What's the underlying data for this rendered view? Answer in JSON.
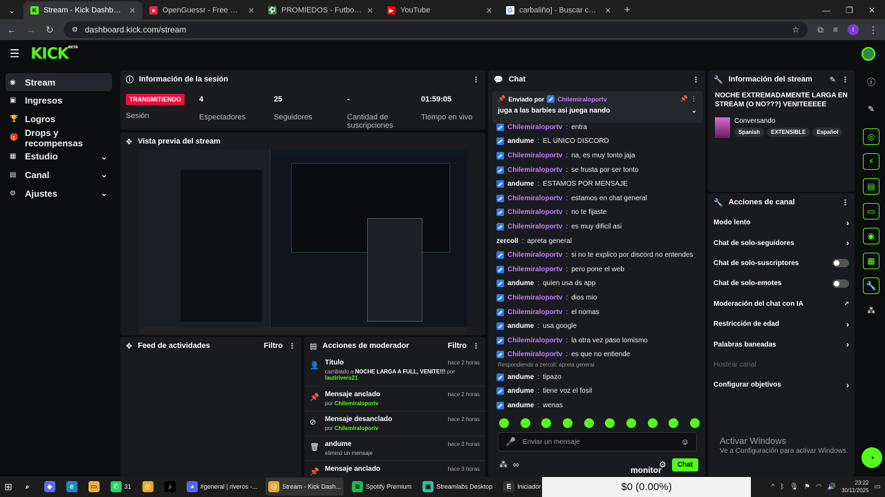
{
  "browser": {
    "tabs": [
      {
        "title": "Stream - Kick Dashboard",
        "icon": "kick-icon",
        "active": true
      },
      {
        "title": "OpenGuessr - Free GeoGuessr A",
        "icon": "openguessr-icon"
      },
      {
        "title": "PROMIEDOS - Futbol Argentino",
        "icon": "promiedos-icon"
      },
      {
        "title": "YouTube",
        "icon": "youtube-icon"
      },
      {
        "title": "carbaliño] - Buscar con Google",
        "icon": "google-icon"
      }
    ],
    "url": "dashboard.kick.com/stream",
    "profile_initial": "I"
  },
  "kick": {
    "logo": "KICK",
    "beta": "BETA"
  },
  "sidebar": {
    "items": [
      {
        "label": "Stream",
        "icon": "broadcast-icon"
      },
      {
        "label": "Ingresos",
        "icon": "wallet-icon"
      },
      {
        "label": "Logros",
        "icon": "trophy-icon"
      },
      {
        "label": "Drops y recompensas",
        "icon": "gift-icon"
      },
      {
        "label": "Estudio",
        "icon": "studio-icon"
      },
      {
        "label": "Canal",
        "icon": "channel-icon"
      },
      {
        "label": "Ajustes",
        "icon": "gear-icon"
      }
    ]
  },
  "session": {
    "title": "Información de la sesión",
    "live_badge": "TRANSMITIENDO",
    "session_label": "Sesión",
    "stats": [
      {
        "value": "4",
        "label": "Espectadores"
      },
      {
        "value": "25",
        "label": "Seguidores"
      },
      {
        "value": "-",
        "label": "Cantidad de suscripciones"
      },
      {
        "value": "01:59:05",
        "label": "Tiempo en vivo"
      }
    ]
  },
  "preview": {
    "title": "Vista previa del stream"
  },
  "activity": {
    "title": "Feed de actividades",
    "filter": "Filtro"
  },
  "moderator": {
    "title": "Acciones de moderador",
    "filter": "Filtro",
    "items": [
      {
        "title": "Título",
        "desc": "cambiado a",
        "highlight": "NOCHE LARGA A FULL, VENITE!!!",
        "suffix": "por",
        "user": "lautirivero21",
        "time": "hace 2 horas",
        "icon": "title-icon"
      },
      {
        "title": "Mensaje anclado",
        "desc": "por",
        "user": "Chilemiraloportv",
        "time": "hace 2 horas",
        "icon": "pin-icon"
      },
      {
        "title": "Mensaje desanclado",
        "desc": "por",
        "user": "Chilemiraloportv",
        "time": "hace 2 horas",
        "icon": "unpin-icon"
      },
      {
        "title": "andume",
        "desc": "eliminó un mensaje",
        "user": "",
        "time": "hace 3 horas",
        "icon": "trash-icon"
      },
      {
        "title": "Mensaje anclado",
        "desc": "",
        "user": "",
        "time": "hace 3 horas",
        "icon": "pin-icon"
      }
    ]
  },
  "chat": {
    "title": "Chat",
    "pinned_by_label": "Enviado por",
    "pinned_user": "Chilemiraloportv",
    "pinned_text": "juga a las barbies asi juega nando",
    "messages": [
      {
        "user": "Chilemiraloportv",
        "text": "entra"
      },
      {
        "user": "andume",
        "text": "EL UNICO DISCORD"
      },
      {
        "user": "Chilemiraloportv",
        "text": "na, es muy tonto jaja"
      },
      {
        "user": "Chilemiraloportv",
        "text": "se frusta por ser tonto"
      },
      {
        "user": "andume",
        "text": "ESTAMOS POR MENSAJE"
      },
      {
        "user": "Chilemiraloportv",
        "text": "estamos en chat general"
      },
      {
        "user": "Chilemiraloportv",
        "text": "no te fijaste"
      },
      {
        "user": "Chilemiraloportv",
        "text": "es muy dificil asi"
      },
      {
        "user": "zercoll",
        "text": "apreta general"
      },
      {
        "user": "Chilemiraloportv",
        "text": "si no te explico por discord no entendes"
      },
      {
        "user": "Chilemiraloportv",
        "text": "pero pone el web"
      },
      {
        "user": "andume",
        "text": "quien usa ds app"
      },
      {
        "user": "Chilemiraloportv",
        "text": "dios mio"
      },
      {
        "user": "Chilemiraloportv",
        "text": "el nomas"
      },
      {
        "user": "andume",
        "text": "usa google"
      },
      {
        "user": "Chilemiraloportv",
        "text": "la otra vez paso lomismo"
      },
      {
        "user": "Chilemiraloportv",
        "text": "es que no entiende"
      }
    ],
    "reply_note": "Respondiendo a zercoll: apreta general",
    "messages2": [
      {
        "user": "andume",
        "text": "tipazo"
      },
      {
        "user": "andume",
        "text": "tiene voz el fosil"
      },
      {
        "user": "andume",
        "text": "wenas"
      }
    ],
    "input_placeholder": "Enviar un mensaje",
    "send_label": "Chat",
    "monitor_label": "monitor"
  },
  "stream_info": {
    "title": "Información del stream",
    "stream_title": "NOCHE EXTREMADAMENTE LARGA EN STREAM (O NO???) VENITEEEEE",
    "category": "Conversando",
    "tags": [
      "Spanish",
      "EXTENSIBLE",
      "Español"
    ]
  },
  "channel_actions": {
    "title": "Acciones de canal",
    "items": [
      {
        "label": "Modo lento",
        "control": "arrow"
      },
      {
        "label": "Chat de solo-seguidores",
        "control": "arrow"
      },
      {
        "label": "Chat de solo-suscriptores",
        "control": "toggle"
      },
      {
        "label": "Chat de solo-emotes",
        "control": "toggle"
      },
      {
        "label": "Moderación del chat con IA",
        "control": "external"
      },
      {
        "label": "Restricción de edad",
        "control": "arrow"
      },
      {
        "label": "Palabras baneadas",
        "control": "arrow"
      },
      {
        "label": "Hostear canal",
        "control": "disabled"
      },
      {
        "label": "Configurar objetivos",
        "control": "arrow"
      }
    ]
  },
  "watermark": {
    "title": "Activar Windows",
    "subtitle": "Ve a Configuración para activar Windows."
  },
  "overlay": {
    "value": "$0 (0.00%)"
  },
  "taskbar": {
    "apps": [
      {
        "label": "",
        "icon": "search-icon"
      },
      {
        "label": "",
        "icon": "copilot-icon"
      },
      {
        "label": "",
        "icon": "edge-icon"
      },
      {
        "label": "",
        "icon": "explorer-icon"
      },
      {
        "label": "31",
        "icon": "whatsapp-icon"
      },
      {
        "label": "",
        "icon": "chrome-icon"
      },
      {
        "label": "",
        "icon": "tiktok-icon"
      },
      {
        "label": "#general | riveros -...",
        "icon": "discord-icon"
      },
      {
        "label": "Stream - Kick Dash...",
        "icon": "chrome-icon",
        "active": true
      },
      {
        "label": "Spotify Premium",
        "icon": "spotify-icon"
      },
      {
        "label": "Streamlabs Desktop",
        "icon": "streamlabs-icon"
      },
      {
        "label": "Iniciador de Epic G...",
        "icon": "epic-icon"
      }
    ],
    "time": "23:22",
    "date": "30/11/2025"
  }
}
